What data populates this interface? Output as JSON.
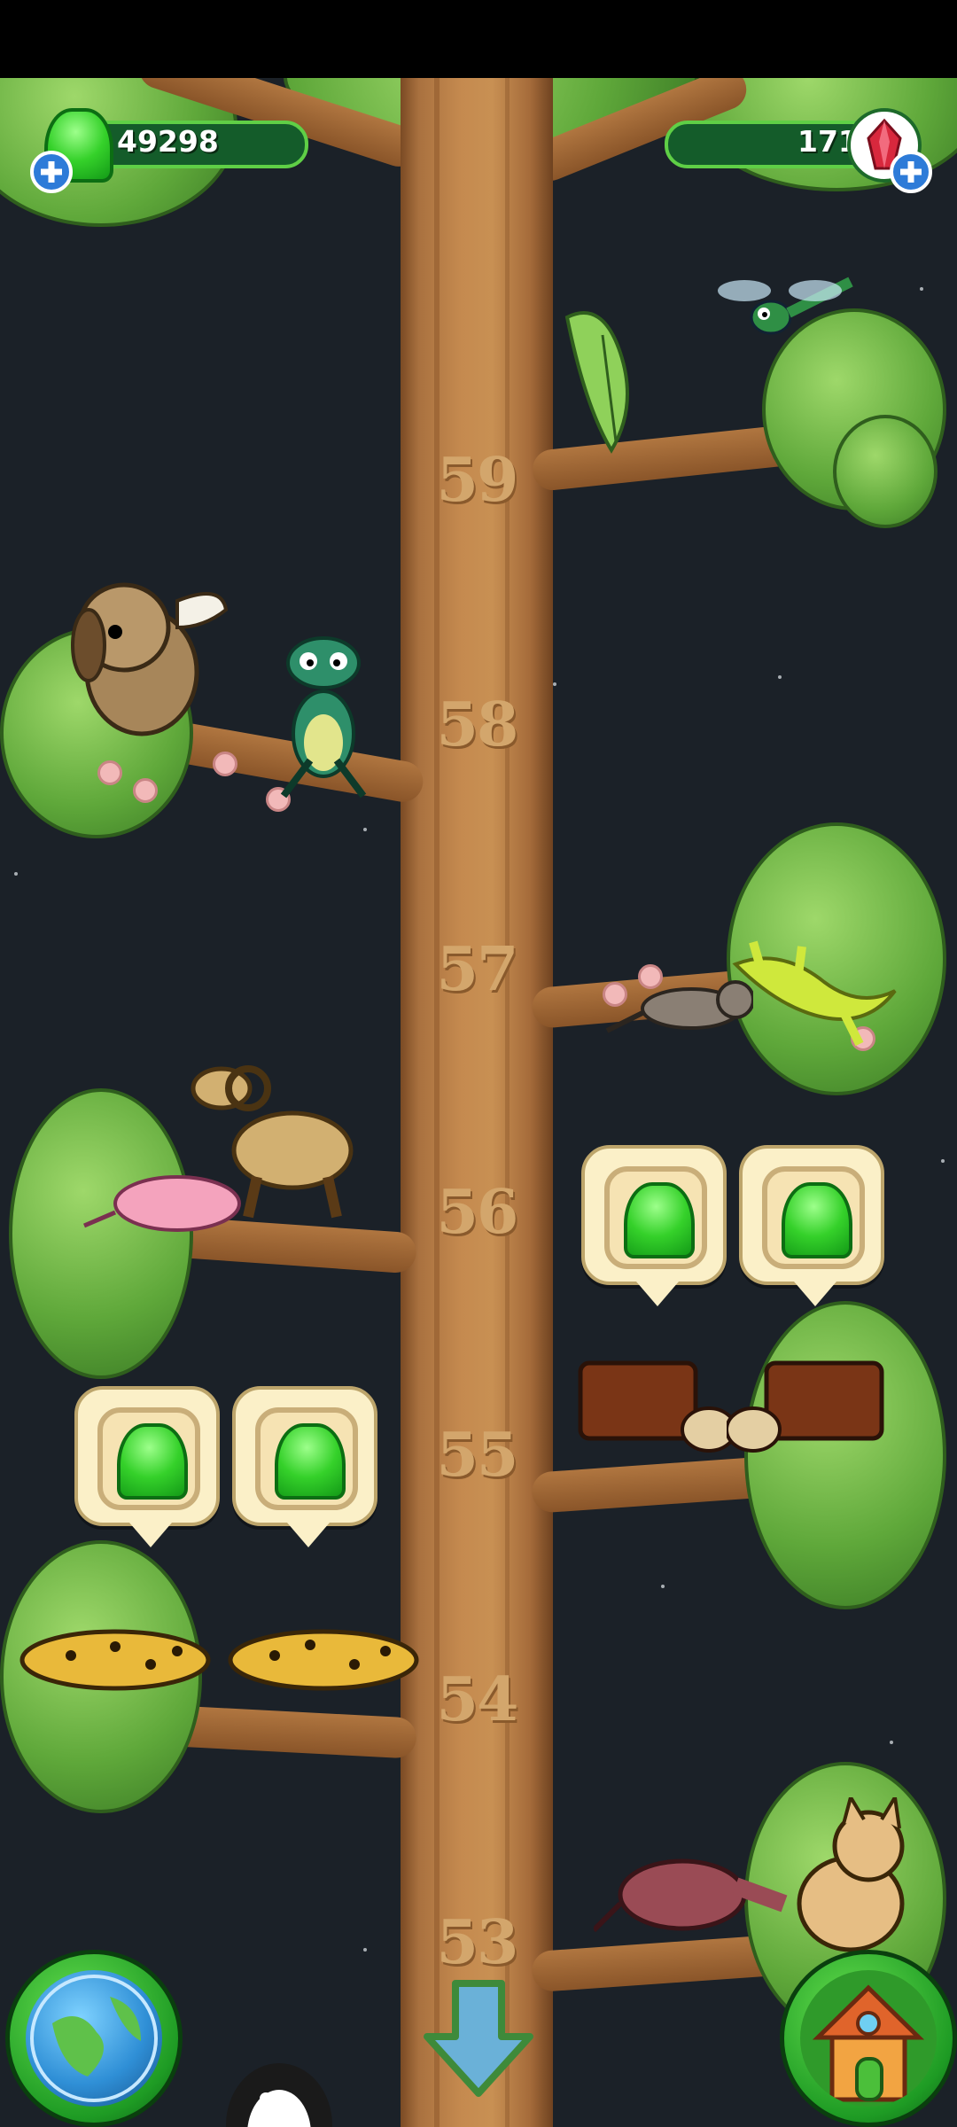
{
  "hud": {
    "gelly_count": "49298",
    "gem_count": "171",
    "gelly_icon": "green-gelly-icon",
    "gem_icon": "red-crystal-icon",
    "add_icon": "plus-icon"
  },
  "tree": {
    "levels": [
      "59",
      "58",
      "57",
      "56",
      "55",
      "54",
      "53"
    ]
  },
  "rewards": {
    "icon": "green-gelly-icon"
  },
  "nav": {
    "globe_icon": "globe-icon",
    "scroll_down_icon": "down-arrow-icon",
    "home_icon": "house-icon"
  },
  "colors": {
    "background": "#1b2128",
    "trunk": "#c58a4f",
    "hud_bar": "#145c2a",
    "gelly_green": "#35d12a",
    "gem_red": "#d8283d"
  }
}
